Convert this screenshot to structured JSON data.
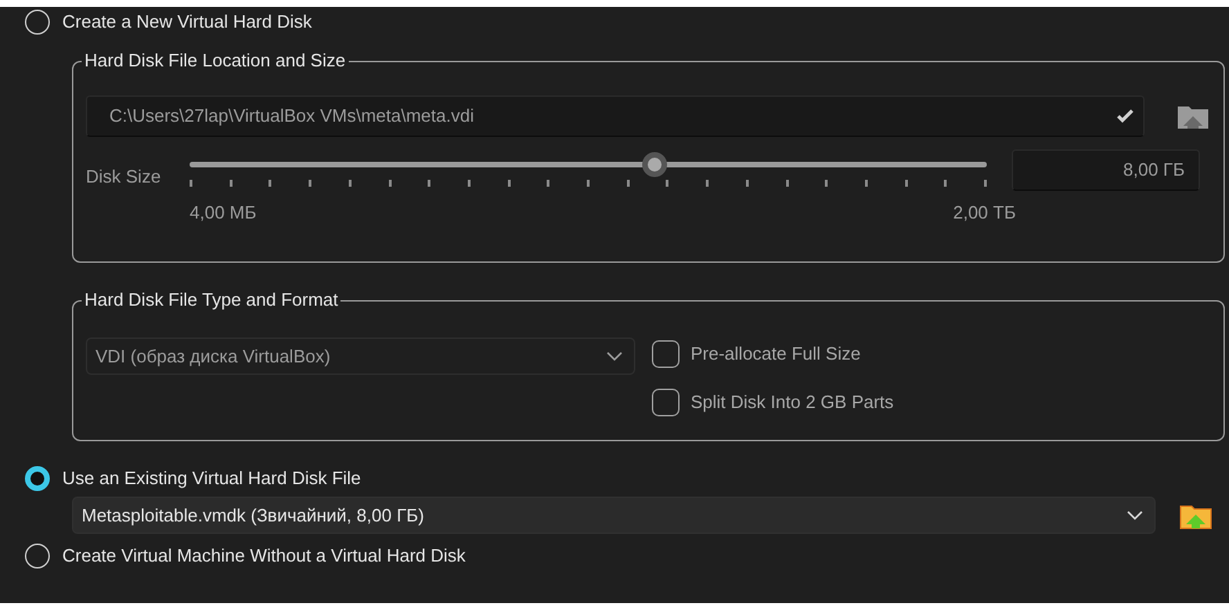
{
  "options": [
    {
      "label": "Create a New Virtual Hard Disk",
      "selected": false
    },
    {
      "label": "Use an Existing Virtual Hard Disk File",
      "selected": true
    },
    {
      "label": "Create Virtual Machine Without a Virtual Hard Disk",
      "selected": false
    }
  ],
  "new_disk": {
    "disabled": true,
    "location_group": {
      "title": "Hard Disk File Location and Size",
      "path": "C:\\Users\\27lap\\VirtualBox VMs\\meta\\meta.vdi",
      "size_label": "Disk Size",
      "slider": {
        "level": 0.584
      },
      "size_value": "8,00 ГБ",
      "min_label": "4,00 МБ",
      "max_label": "2,00 ТБ"
    },
    "format_group": {
      "title": "Hard Disk File Type and Format",
      "format": "VDI (образ диска VirtualBox)",
      "checkboxes": [
        {
          "label": "Pre-allocate Full Size",
          "checked": false
        },
        {
          "label": "Split Disk Into 2 GB Parts",
          "checked": false
        }
      ]
    }
  },
  "existing_disk": {
    "value": "Metasploitable.vmdk (Звичайний, 8,00 ГБ)"
  }
}
